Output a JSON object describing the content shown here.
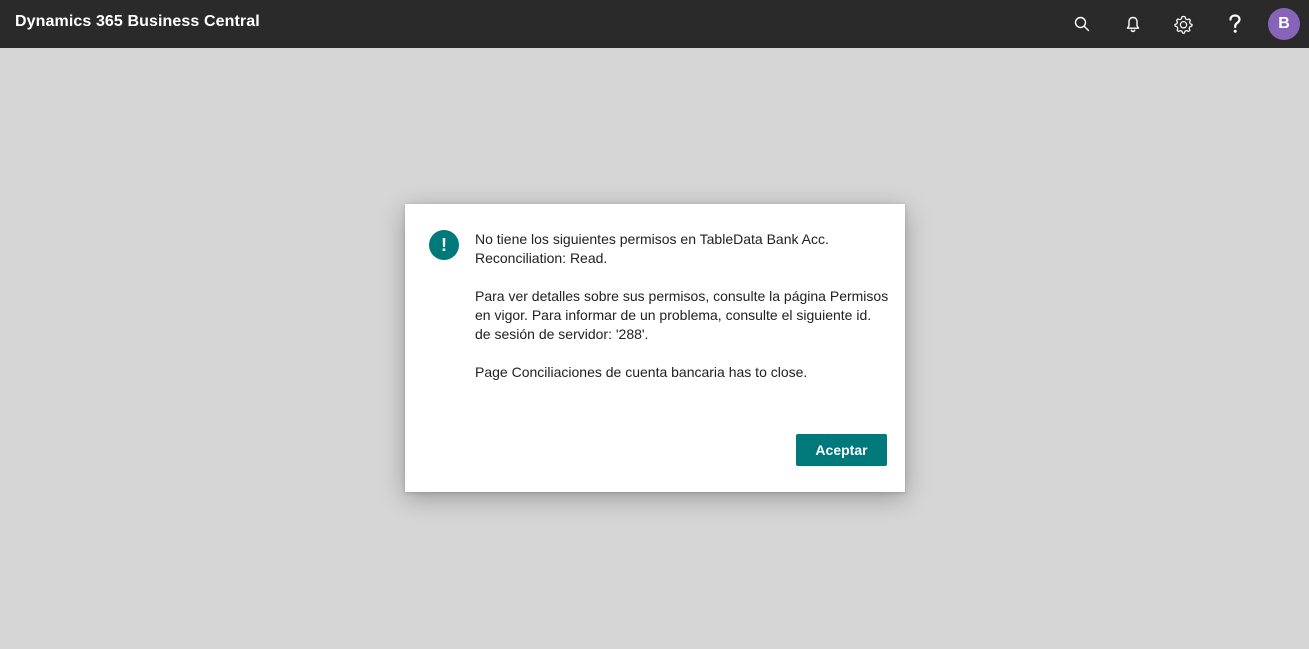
{
  "app": {
    "title": "Dynamics 365 Business Central"
  },
  "topbar": {
    "icons": [
      "search-icon",
      "bell-icon",
      "gear-icon",
      "help-icon"
    ],
    "avatar_initial": "B",
    "avatar_color": "#8764b8",
    "background": "#2a2a2a"
  },
  "dialog": {
    "icon_glyph": "!",
    "icon_color": "#00797b",
    "message_line_1": "No tiene los siguientes permisos en TableData Bank Acc. Reconciliation: Read.",
    "message_line_2": "Para ver detalles sobre sus permisos, consulte la página Permisos en vigor. Para informar de un problema, consulte el siguiente id. de sesión de servidor: '288'.",
    "message_line_3": "Page Conciliaciones de cuenta bancaria has to close.",
    "ok_label": "Aceptar",
    "accent": "#00797b"
  }
}
